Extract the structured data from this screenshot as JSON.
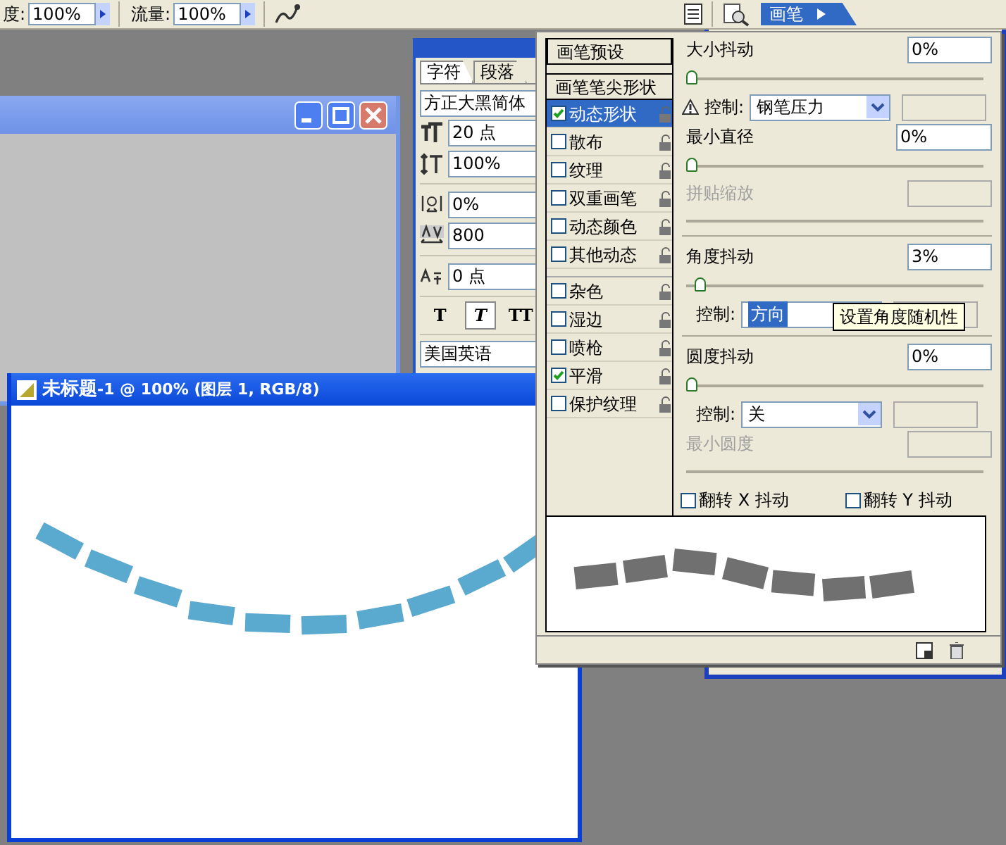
{
  "options_bar": {
    "opacity_label": "度:",
    "opacity": "100%",
    "flow_label": "流量:",
    "flow": "100%"
  },
  "palette_well": {
    "tab": "画笔"
  },
  "character_panel": {
    "tabs": [
      {
        "label": "字符",
        "selected": true
      },
      {
        "label": "段落",
        "selected": false
      }
    ],
    "font": "方正大黑简体",
    "fields": [
      {
        "kind": "size",
        "value": "20 点"
      },
      {
        "kind": "scale",
        "value": "100%"
      },
      {
        "kind": "tsume",
        "value": "0%"
      },
      {
        "kind": "tracking",
        "value": "800"
      },
      {
        "kind": "baseline",
        "value": "0 点"
      }
    ],
    "style_buttons": [
      {
        "label": "T",
        "kind": "bold",
        "selected": false
      },
      {
        "label": "T",
        "kind": "italic",
        "selected": true
      },
      {
        "label": "TT",
        "kind": "caps",
        "selected": false
      }
    ],
    "language": "美国英语"
  },
  "brush_panel": {
    "presets": "画笔预设",
    "tip_shape": "画笔笔尖形状",
    "options": [
      {
        "label": "动态形状",
        "checked": true,
        "selected": true
      },
      {
        "label": "散布",
        "checked": false,
        "selected": false
      },
      {
        "label": "纹理",
        "checked": false,
        "selected": false
      },
      {
        "label": "双重画笔",
        "checked": false,
        "selected": false
      },
      {
        "label": "动态颜色",
        "checked": false,
        "selected": false
      },
      {
        "label": "其他动态",
        "checked": false,
        "selected": false
      }
    ],
    "extras": [
      {
        "label": "杂色",
        "checked": false,
        "selected": false
      },
      {
        "label": "湿边",
        "checked": false,
        "selected": false
      },
      {
        "label": "喷枪",
        "checked": false,
        "selected": false
      },
      {
        "label": "平滑",
        "checked": true,
        "selected": false
      },
      {
        "label": "保护纹理",
        "checked": false,
        "selected": false
      }
    ],
    "settings": [
      {
        "kind": "slider",
        "label": "大小抖动",
        "value": "0%",
        "level": 0
      },
      {
        "kind": "control",
        "label": "控制:",
        "value": "钢笔压力",
        "warning": true
      },
      {
        "kind": "slider",
        "label": "最小直径",
        "value": "0%",
        "level": 0
      },
      {
        "kind": "slider",
        "label": "拼贴缩放",
        "disabled": true
      },
      {
        "kind": "divider"
      },
      {
        "kind": "slider",
        "label": "角度抖动",
        "value": "3%",
        "level": 0.03
      },
      {
        "kind": "control",
        "label": "控制:",
        "value": "方向",
        "highlighted": true,
        "tooltip": "设置角度随机性"
      },
      {
        "kind": "divider"
      },
      {
        "kind": "slider",
        "label": "圆度抖动",
        "value": "0%",
        "level": 0
      },
      {
        "kind": "control",
        "label": "控制:",
        "value": "关"
      },
      {
        "kind": "slider",
        "label": "最小圆度",
        "disabled": true
      }
    ],
    "flips": [
      {
        "label": "翻转 X 抖动",
        "checked": false
      },
      {
        "label": "翻转 Y 抖动",
        "checked": false
      }
    ]
  },
  "document": {
    "title_prefix": "未标题",
    "title_rest": "-1 @ 100% (图层 1, RGB/8)"
  }
}
